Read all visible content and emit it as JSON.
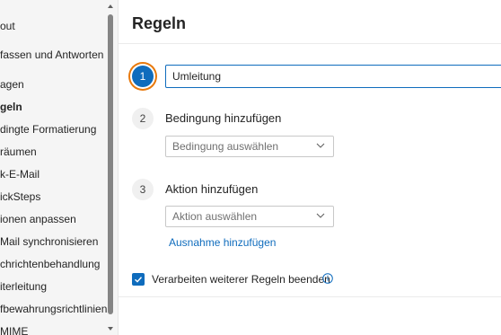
{
  "sidebar": {
    "items": [
      {
        "label": "out",
        "active": false
      },
      {
        "label": "fassen und Antworten",
        "active": false
      },
      {
        "label": "agen",
        "active": false
      },
      {
        "label": "geln",
        "active": true
      },
      {
        "label": "dingte Formatierung",
        "active": false
      },
      {
        "label": "räumen",
        "active": false
      },
      {
        "label": "k-E-Mail",
        "active": false
      },
      {
        "label": "ickSteps",
        "active": false
      },
      {
        "label": "ionen anpassen",
        "active": false
      },
      {
        "label": "Mail synchronisieren",
        "active": false
      },
      {
        "label": "chrichtenbehandlung",
        "active": false
      },
      {
        "label": "iterleitung",
        "active": false
      },
      {
        "label": "fbewahrungsrichtlinien",
        "active": false
      },
      {
        "label": "MIME",
        "active": false
      }
    ]
  },
  "main": {
    "title": "Regeln",
    "step1": {
      "number": "1",
      "value": "Umleitung"
    },
    "step2": {
      "number": "2",
      "heading": "Bedingung hinzufügen",
      "dropdown_placeholder": "Bedingung auswählen"
    },
    "step3": {
      "number": "3",
      "heading": "Aktion hinzufügen",
      "dropdown_placeholder": "Aktion auswählen",
      "exception_link": "Ausnahme hinzufügen"
    },
    "stop_processing": {
      "label": "Verarbeiten weiterer Regeln beenden",
      "checked": true
    }
  },
  "colors": {
    "accent": "#0f6cbd",
    "focus_ring": "#e8790c"
  }
}
